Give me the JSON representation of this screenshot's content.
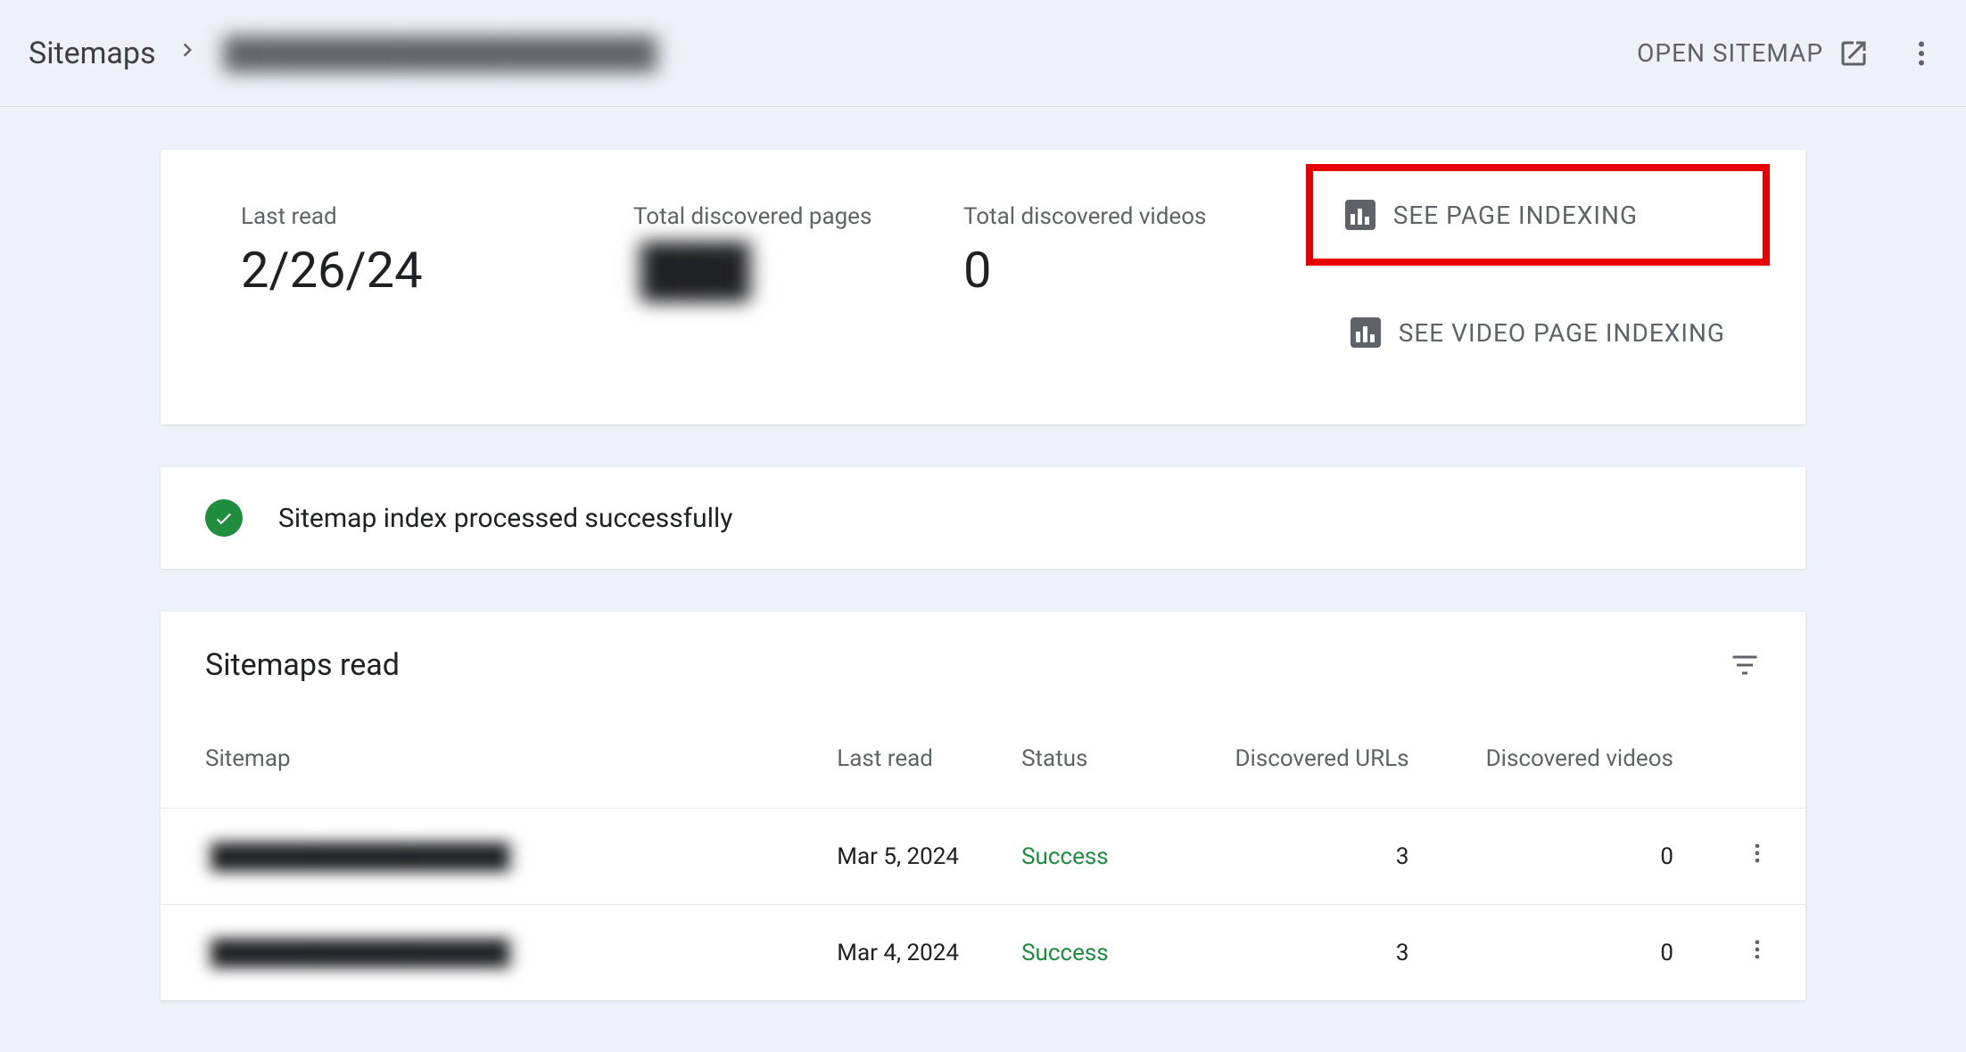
{
  "header": {
    "breadcrumb_root": "Sitemaps",
    "breadcrumb_current": "████████████████████",
    "open_sitemap_label": "OPEN SITEMAP"
  },
  "stats": {
    "last_read_label": "Last read",
    "last_read_value": "2/26/24",
    "pages_label": "Total discovered pages",
    "pages_value": "███",
    "videos_label": "Total discovered videos",
    "videos_value": "0",
    "see_page_indexing": "SEE PAGE INDEXING",
    "see_video_indexing": "SEE VIDEO PAGE INDEXING"
  },
  "status": {
    "message": "Sitemap index processed successfully"
  },
  "table": {
    "title": "Sitemaps read",
    "columns": {
      "sitemap": "Sitemap",
      "last_read": "Last read",
      "status": "Status",
      "urls": "Discovered URLs",
      "videos": "Discovered videos"
    },
    "rows": [
      {
        "sitemap": "██████████████████",
        "last_read": "Mar 5, 2024",
        "status": "Success",
        "urls": "3",
        "videos": "0"
      },
      {
        "sitemap": "██████████████████",
        "last_read": "Mar 4, 2024",
        "status": "Success",
        "urls": "3",
        "videos": "0"
      }
    ]
  }
}
